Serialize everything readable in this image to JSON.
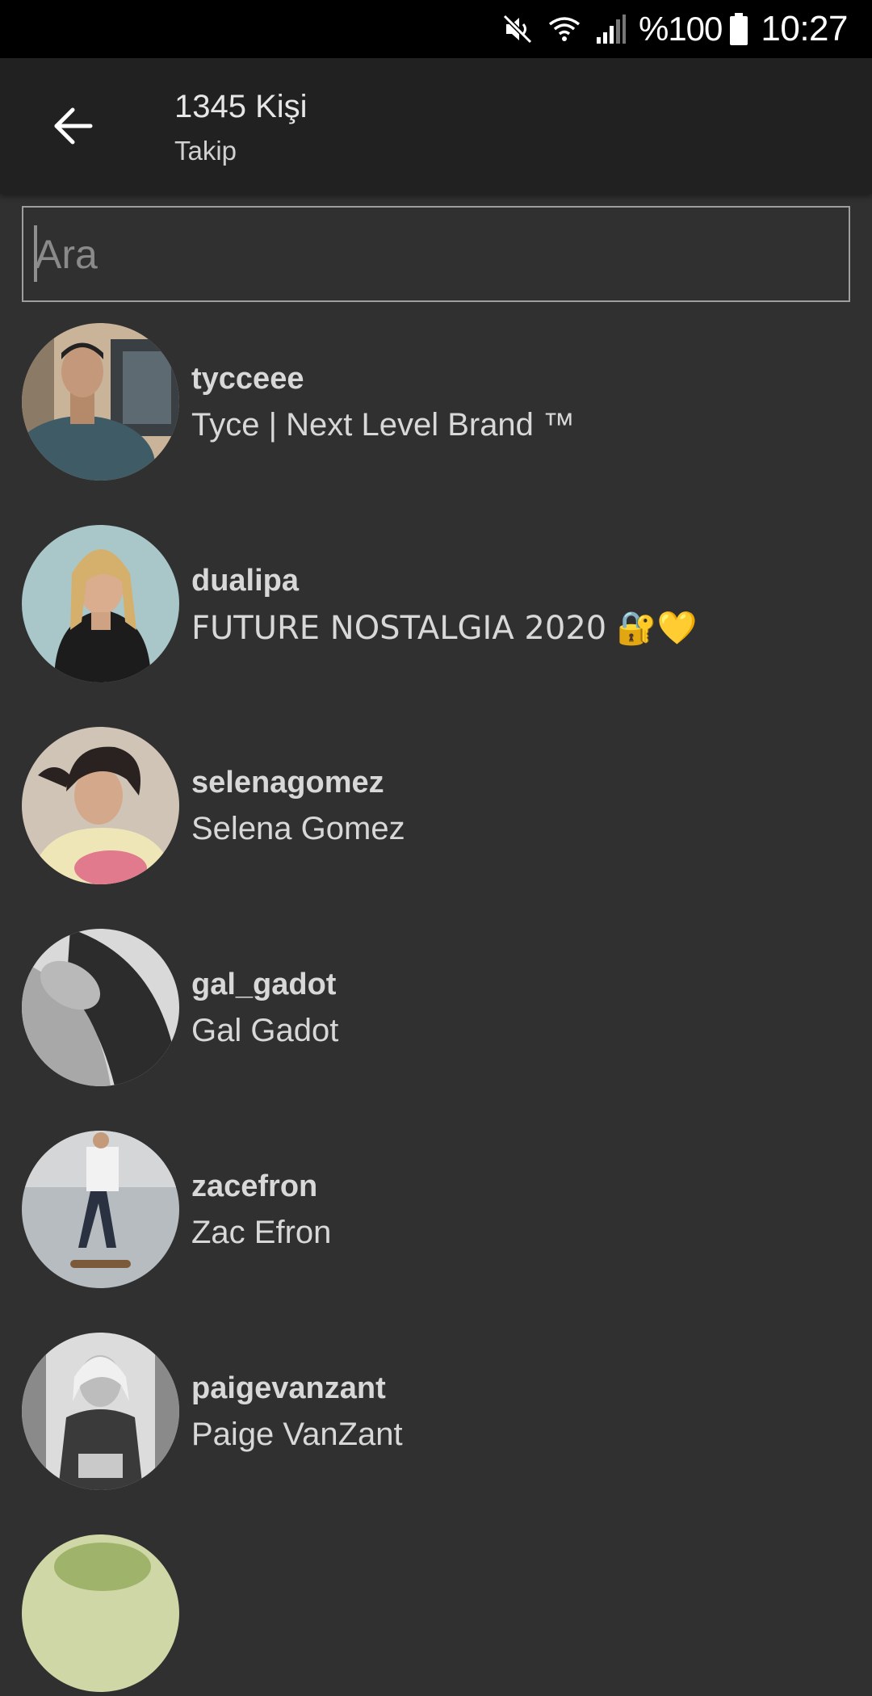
{
  "status_bar": {
    "battery": "%100",
    "time": "10:27",
    "icons": [
      "mute-icon",
      "wifi-icon",
      "signal-icon",
      "battery-icon"
    ]
  },
  "app_bar": {
    "back_icon": "arrow-left-icon",
    "title": "1345 Kişi",
    "subtitle": "Takip"
  },
  "search": {
    "placeholder": "Ara",
    "value": ""
  },
  "users": [
    {
      "username": "tycceee",
      "full_name": "Tyce | Next Level Brand ™"
    },
    {
      "username": "dualipa",
      "full_name": "FUTURE NOSTALGIA 2020 🔐💛"
    },
    {
      "username": "selenagomez",
      "full_name": "Selena Gomez"
    },
    {
      "username": "gal_gadot",
      "full_name": "Gal Gadot"
    },
    {
      "username": "zacefron",
      "full_name": "Zac Efron"
    },
    {
      "username": "paigevanzant",
      "full_name": "Paige VanZant"
    }
  ],
  "colors": {
    "background": "#303030",
    "app_bar": "#212121",
    "status_bar": "#000000",
    "text": "#d8d8d8"
  }
}
